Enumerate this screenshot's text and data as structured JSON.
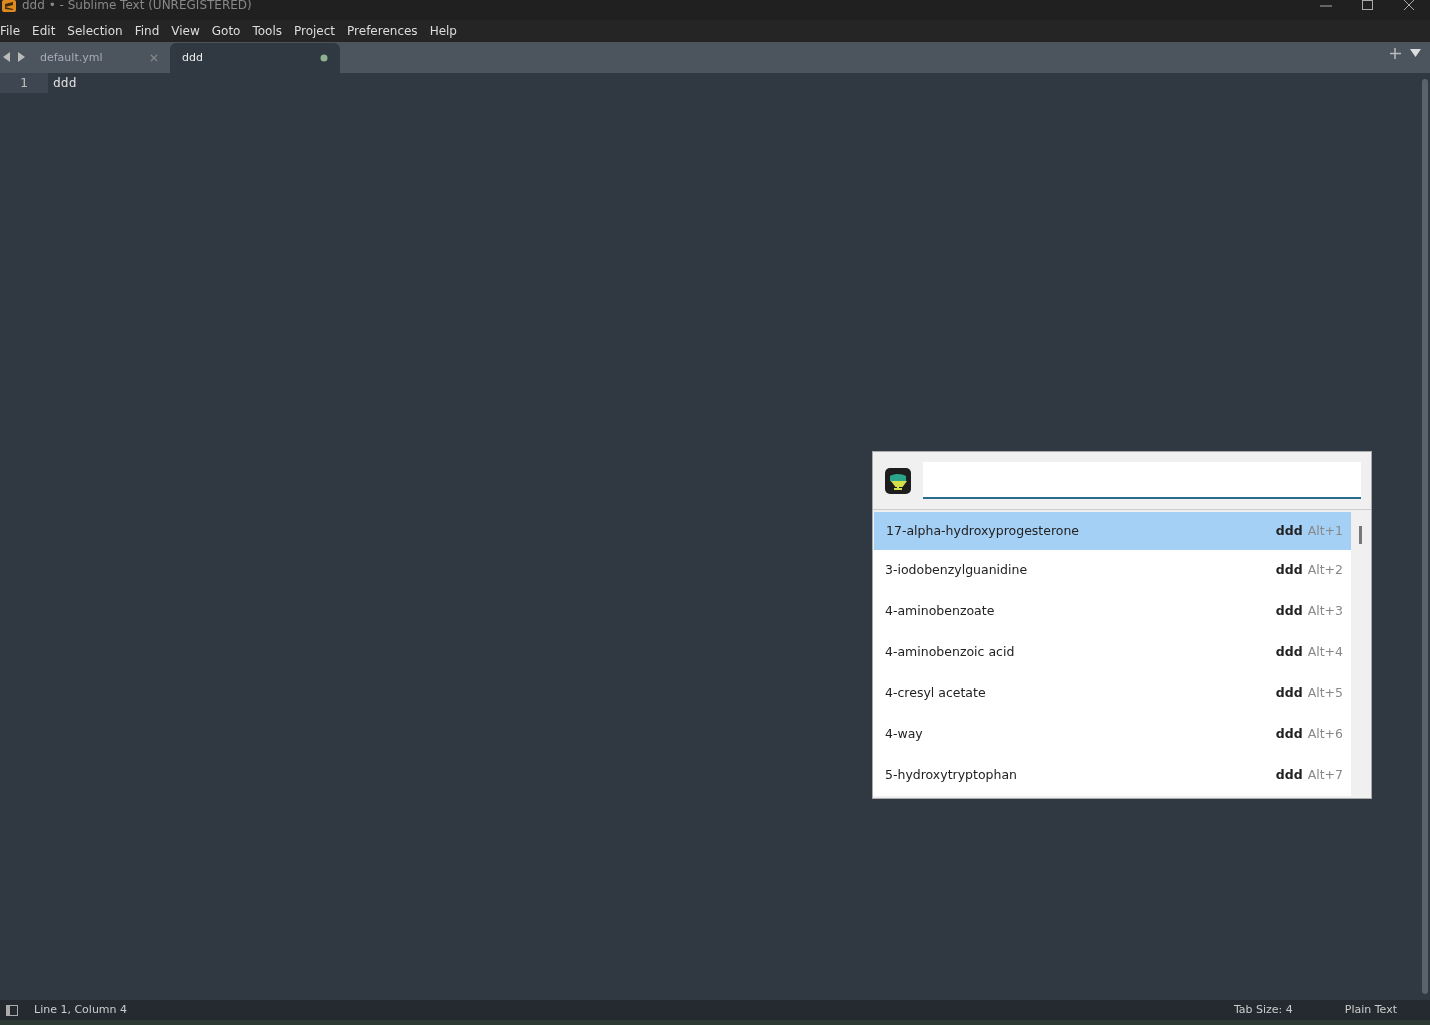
{
  "window": {
    "title": "ddd • - Sublime Text (UNREGISTERED)"
  },
  "menu": [
    "File",
    "Edit",
    "Selection",
    "Find",
    "View",
    "Goto",
    "Tools",
    "Project",
    "Preferences",
    "Help"
  ],
  "tabs": [
    {
      "label": "default.yml",
      "selected": false,
      "modified": false
    },
    {
      "label": "ddd",
      "selected": true,
      "modified": true
    }
  ],
  "editor": {
    "lines": [
      {
        "number": "1",
        "text": "ddd"
      }
    ]
  },
  "popup": {
    "items": [
      {
        "label": "17-alpha-hydroxyprogesterone",
        "source": "ddd",
        "shortcut": "Alt+1",
        "selected": true
      },
      {
        "label": "3-iodobenzylguanidine",
        "source": "ddd",
        "shortcut": "Alt+2",
        "selected": false
      },
      {
        "label": "4-aminobenzoate",
        "source": "ddd",
        "shortcut": "Alt+3",
        "selected": false
      },
      {
        "label": "4-aminobenzoic acid",
        "source": "ddd",
        "shortcut": "Alt+4",
        "selected": false
      },
      {
        "label": "4-cresyl acetate",
        "source": "ddd",
        "shortcut": "Alt+5",
        "selected": false
      },
      {
        "label": "4-way",
        "source": "ddd",
        "shortcut": "Alt+6",
        "selected": false
      },
      {
        "label": "5-hydroxytryptophan",
        "source": "ddd",
        "shortcut": "Alt+7",
        "selected": false
      }
    ]
  },
  "status_bar": {
    "position": "Line 1, Column 4",
    "tab_size": "Tab Size: 4",
    "syntax": "Plain Text"
  }
}
